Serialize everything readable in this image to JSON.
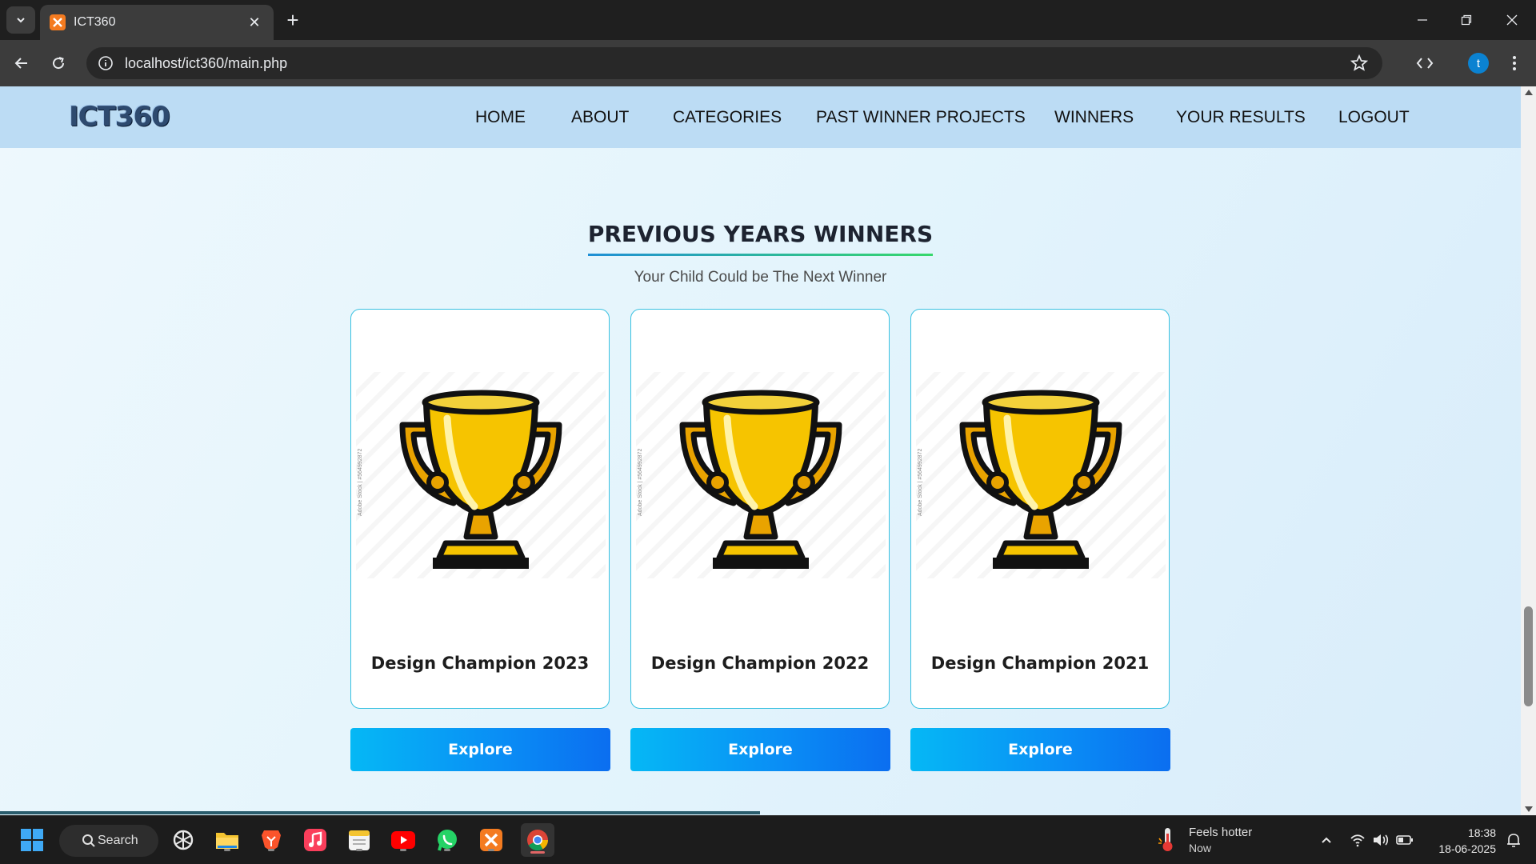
{
  "browser": {
    "tab_title": "ICT360",
    "tab_close": "✕",
    "new_tab": "+",
    "url": "localhost/ict360/main.php",
    "profile_initial": "t"
  },
  "site": {
    "logo_text": "ICT360",
    "nav": [
      "HOME",
      "ABOUT",
      "CATEGORIES",
      "PAST WINNER PROJECTS",
      "WINNERS",
      "YOUR RESULTS",
      "LOGOUT"
    ]
  },
  "section": {
    "title": "PREVIOUS YEARS WINNERS",
    "subtitle": "Your Child Could be The Next Winner"
  },
  "cards": [
    {
      "title": "Design Champion 2023",
      "button": "Explore",
      "watermark": "Adobe Stock | #564992872"
    },
    {
      "title": "Design Champion 2022",
      "button": "Explore",
      "watermark": "Adobe Stock | #564992872"
    },
    {
      "title": "Design Champion 2021",
      "button": "Explore",
      "watermark": "Adobe Stock | #564992872"
    }
  ],
  "taskbar": {
    "search_label": "Search",
    "weather_line1": "Feels hotter",
    "weather_line2": "Now",
    "time": "18:38",
    "date": "18-06-2025"
  },
  "colors": {
    "nav_bg": "#bcdcf4",
    "card_border": "#39c1e0",
    "button_gradient_start": "#05b8f5",
    "button_gradient_end": "#0b6ef0",
    "title_underline_start": "#1f8fd6",
    "title_underline_end": "#37d86b"
  }
}
